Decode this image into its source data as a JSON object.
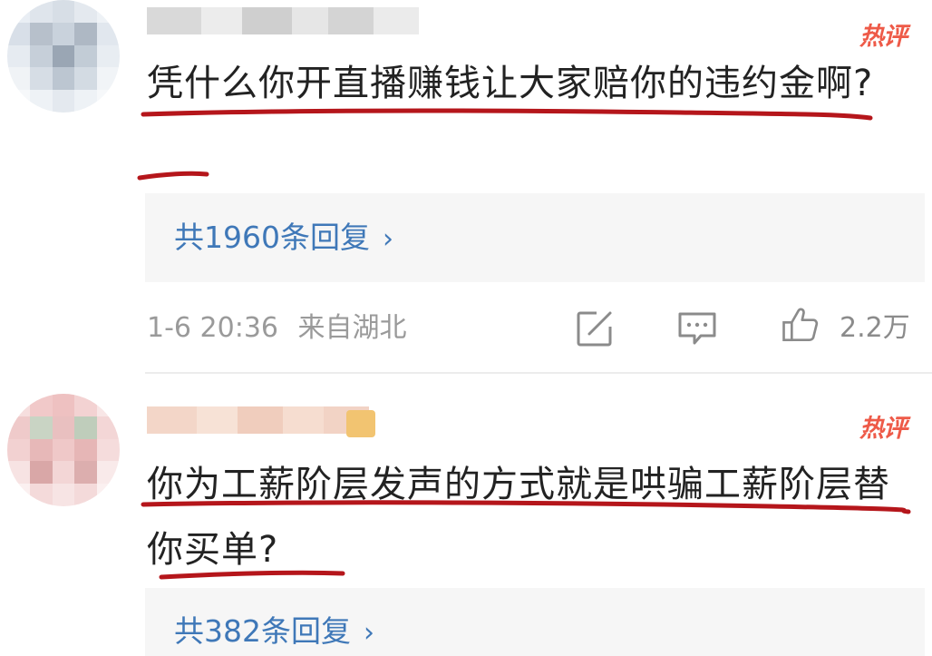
{
  "comments": [
    {
      "hot_label": "热评",
      "text": "凭什么你开直播赚钱让大家赔你的违约金啊?",
      "replies_label": "共1960条回复",
      "timestamp": "1-6 20:36",
      "location": "来自湖北",
      "likes": "2.2万"
    },
    {
      "hot_label": "热评",
      "text": "你为工薪阶层发声的方式就是哄骗工薪阶层替你买单?",
      "replies_label": "共382条回复"
    }
  ],
  "colors": {
    "underline": "#b5161b",
    "link": "#3f78b8",
    "hot": "#ee5a48",
    "text": "#222222",
    "meta": "#9a9a9a"
  },
  "icons": [
    "share-icon",
    "comment-icon",
    "like-icon",
    "chevron-right-icon"
  ]
}
